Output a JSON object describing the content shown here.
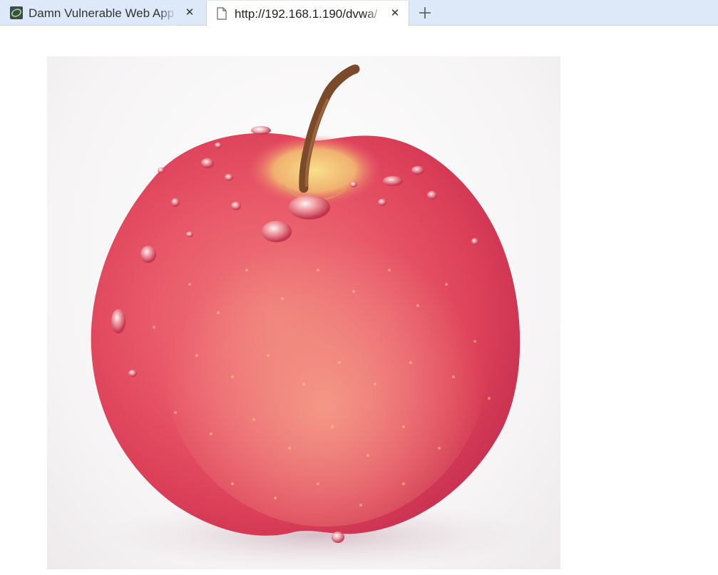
{
  "browser": {
    "tabs": [
      {
        "title": "Damn Vulnerable Web App",
        "active": false,
        "icon": "dvwa-logo-icon"
      },
      {
        "title": "http://192.168.1.190/dvwa/",
        "active": true,
        "icon": "blank-page-icon"
      }
    ],
    "new_tab_icon": "plus-icon",
    "close_icon": "close-icon"
  },
  "page": {
    "image": {
      "subject": "red-apple",
      "colors": {
        "apple_main": "#e4475c",
        "apple_light": "#f08a80",
        "stem": "#7a4a2a",
        "background": "#f7f5f6"
      }
    }
  }
}
